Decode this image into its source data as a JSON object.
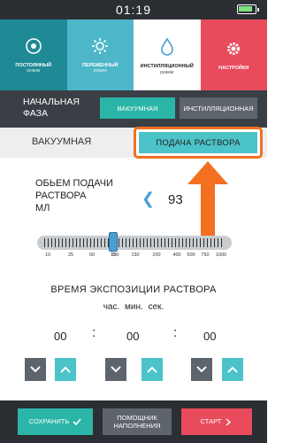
{
  "statusbar": {
    "time": "01:19",
    "battery_icon": "battery-icon"
  },
  "modes": [
    {
      "label": "ПОСТОЯННЫЙ",
      "sub": "режим",
      "icon": "circle-target-icon",
      "color": "#1f8a96"
    },
    {
      "label": "ПЕРЕМЕННЫЙ",
      "sub": "режим",
      "icon": "sun-gear-icon",
      "color": "#4db6c9"
    },
    {
      "label": "ИНСТИЛЛЯЦИОННЫЙ",
      "sub": "режим",
      "icon": "drop-icon",
      "color": "#ffffff"
    },
    {
      "label": "НАСТРОЙКИ",
      "sub": "",
      "icon": "gear-icon",
      "color": "#e84b5c"
    }
  ],
  "phase": {
    "title_line1": "НАЧАЛЬНАЯ",
    "title_line2": "ФАЗА",
    "vacuum": "ВАКУУМНАЯ",
    "instillation": "ИНСТИЛЛЯЦИОННАЯ"
  },
  "tabs": {
    "vacuum": "ВАКУУМНАЯ",
    "feed": "ПОДАЧА РАСТВОРА"
  },
  "volume": {
    "label_line1": "ОБЬЕМ ПОДАЧИ",
    "label_line2": "РАСТВОРА",
    "label_line3": "МЛ",
    "value": "93",
    "prev_icon": "chevron-left-icon",
    "next_icon": "chevron-right-icon"
  },
  "slider": {
    "scale": [
      "10",
      "25",
      "50",
      "75",
      "100",
      "150",
      "200",
      "400",
      "500",
      "750",
      "1000",
      "2000"
    ],
    "value": 93
  },
  "exposure": {
    "title": "ВРЕМЯ ЭКСПОЗИЦИИ РАСТВОРА",
    "units": "час. мин. сек.",
    "hours": "00",
    "minutes": "00",
    "seconds": "00",
    "separator": ":"
  },
  "bottom": {
    "save": "СОХРАНИТЬ",
    "help_line1": "ПОМОЩНИК",
    "help_line2": "НАПОЛНЕНИЯ",
    "start": "СТАРТ"
  },
  "colors": {
    "accent": "#4cc3c8",
    "teal": "#2bb5a8",
    "red": "#e84b5c",
    "highlight": "#f37021",
    "dark": "#2b2e33"
  }
}
